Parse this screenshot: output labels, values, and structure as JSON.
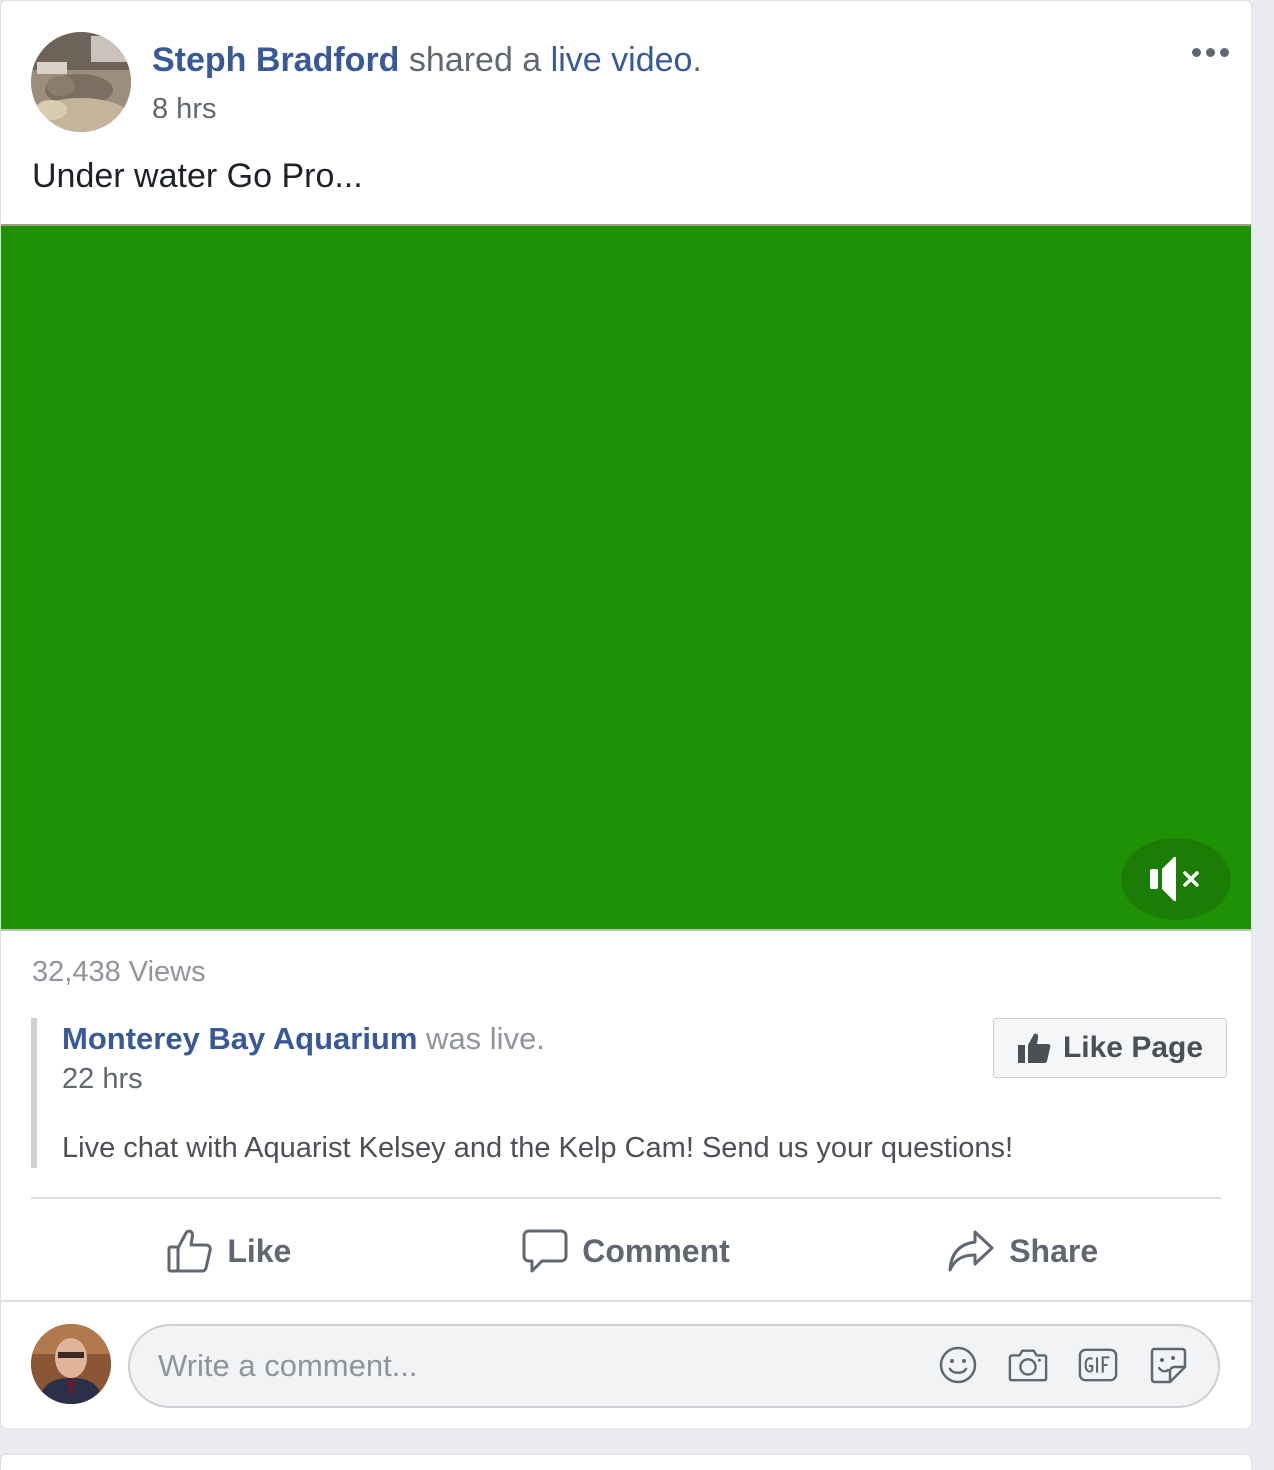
{
  "post": {
    "author_name": "Steph Bradford",
    "action_text": " shared a ",
    "live_link": "live video",
    "period": ".",
    "time": "8 hrs",
    "text": "Under water Go Pro...",
    "views": "32,438 Views"
  },
  "shared": {
    "page_name": "Monterey Bay Aquarium",
    "status": " was live.",
    "time": "22 hrs",
    "description": "Live chat with Aquarist Kelsey and the Kelp Cam! Send us your questions!",
    "like_page_label": "Like Page"
  },
  "actions": {
    "like": "Like",
    "comment": "Comment",
    "share": "Share"
  },
  "comment": {
    "placeholder": "Write a comment..."
  },
  "icons": [
    "more-icon",
    "mute-icon",
    "thumbs-up-icon",
    "comment-icon",
    "share-icon",
    "emoji-icon",
    "camera-icon",
    "gif-icon",
    "sticker-icon"
  ],
  "colors": {
    "link": "#385898",
    "video_bg": "#1f9105",
    "muted_text": "#606770"
  }
}
